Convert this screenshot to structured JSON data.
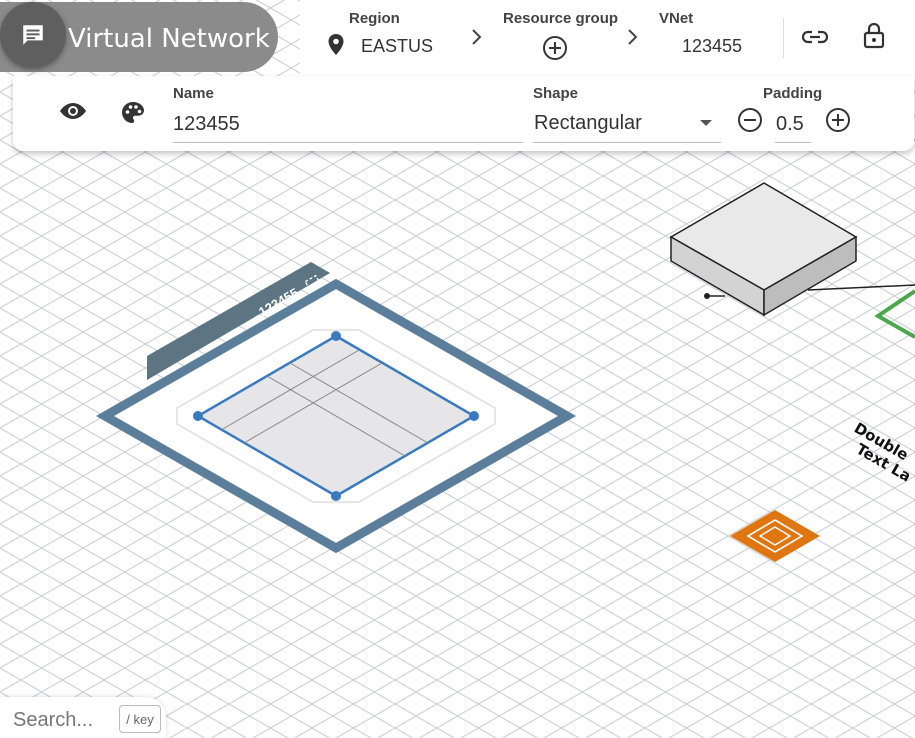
{
  "app": {
    "title": "Virtual Network",
    "menu_icon": "chat-icon"
  },
  "top_bar": {
    "region": {
      "label": "Region",
      "value": "EASTUS",
      "icon": "location-pin-icon"
    },
    "resource_group": {
      "label": "Resource group",
      "icon": "add-circle-icon"
    },
    "vnet": {
      "label": "VNet",
      "value": "123455"
    },
    "actions": [
      "link-icon",
      "lock-open-icon"
    ]
  },
  "properties": {
    "name": {
      "label": "Name",
      "value": "123455"
    },
    "shape": {
      "label": "Shape",
      "value": "Rectangular"
    },
    "padding": {
      "label": "Padding",
      "value": "0.5"
    }
  },
  "canvas": {
    "vnet_label": "123455",
    "text_label_line1": "Double",
    "text_label_line2": "Text La"
  },
  "search": {
    "placeholder": "Search...",
    "shortcut": "/ key"
  }
}
